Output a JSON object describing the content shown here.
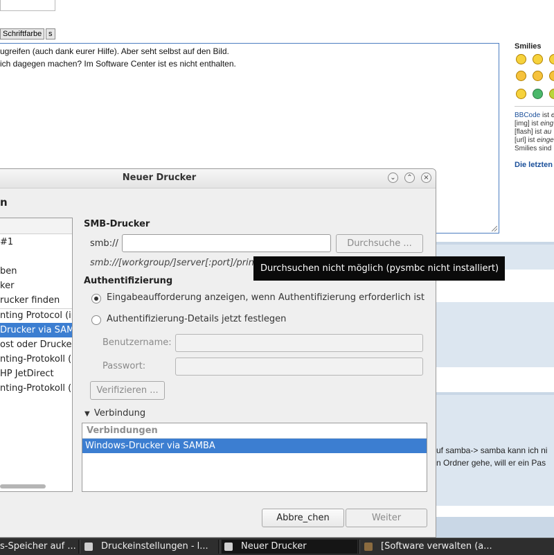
{
  "forum": {
    "format_buttons": [
      "Schriftfarbe",
      "s"
    ],
    "editor_lines": [
      "ugreifen (auch dank eurer Hilfe). Aber seht selbst auf den Bild.",
      "ich dagegen machen? Im Software Center ist es nicht enthalten."
    ],
    "smilies_title": "Smilies",
    "bbcode": {
      "line1_link": "BBCode",
      "line1_rest": " ist ",
      "line1_em": "e",
      "line2_pre": "[img] ist ",
      "line2_em": "eing",
      "line3_pre": "[flash] ist ",
      "line3_em": "au",
      "line4_pre": "[url] ist ",
      "line4_em": "einge",
      "line5": "Smilies sind"
    },
    "letzten": "Die letzten",
    "post_lines": [
      "uf samba-> samba kann ich ni",
      "n Ordner gehe, will er ein Pas"
    ]
  },
  "dialog": {
    "title": "Neuer Drucker",
    "heading_fragment": "n",
    "device_list": [
      {
        "label": "#1",
        "selected": false
      },
      {
        "label": "",
        "selected": false
      },
      {
        "label": "ben",
        "selected": false
      },
      {
        "label": "ker",
        "selected": false
      },
      {
        "label": "rucker finden",
        "selected": false
      },
      {
        "label": "nting Protocol (ip",
        "selected": false
      },
      {
        "label": "Drucker via SAMB",
        "selected": true
      },
      {
        "label": "ost oder Drucker",
        "selected": false
      },
      {
        "label": "nting-Protokoll (",
        "selected": false
      },
      {
        "label": "HP JetDirect",
        "selected": false
      },
      {
        "label": "nting-Protokoll (",
        "selected": false
      }
    ],
    "smb_section": "SMB-Drucker",
    "smb_prefix": "smb://",
    "smb_value": "",
    "browse_button": "Durchsuche ...",
    "smb_hint": "smb://[workgroup/]server[:port]/print",
    "tooltip": "Durchsuchen nicht möglich (pysmbc nicht installiert)",
    "auth_section": "Authentifizierung",
    "auth_options": [
      {
        "label": "Eingabeaufforderung anzeigen, wenn Authentifizierung erforderlich ist",
        "selected": true
      },
      {
        "label": "Authentifizierung-Details jetzt festlegen",
        "selected": false
      }
    ],
    "username_label": "Benutzername:",
    "username_value": "",
    "password_label": "Passwort:",
    "password_value": "",
    "verify_button": "Verifizieren ...",
    "connection_expander": "Verbindung",
    "connections_header": "Verbindungen",
    "connection_selected": "Windows-Drucker via SAMBA",
    "cancel_button": "Abbre_chen",
    "next_button": "Weiter"
  },
  "taskbar": {
    "tasks": [
      {
        "label": "s-Speicher auf ...",
        "active": false
      },
      {
        "label": "Druckeinstellungen - l...",
        "active": false
      },
      {
        "label": "Neuer Drucker",
        "active": true
      },
      {
        "label": "[Software verwalten (a...",
        "active": false
      }
    ]
  },
  "colors": {
    "selection": "#3c7ed1",
    "editor_border": "#4a7cc0",
    "link": "#1a4f9a",
    "tooltip_bg": "#0a0a0a",
    "taskbar_bg": "#2e2e2e"
  }
}
